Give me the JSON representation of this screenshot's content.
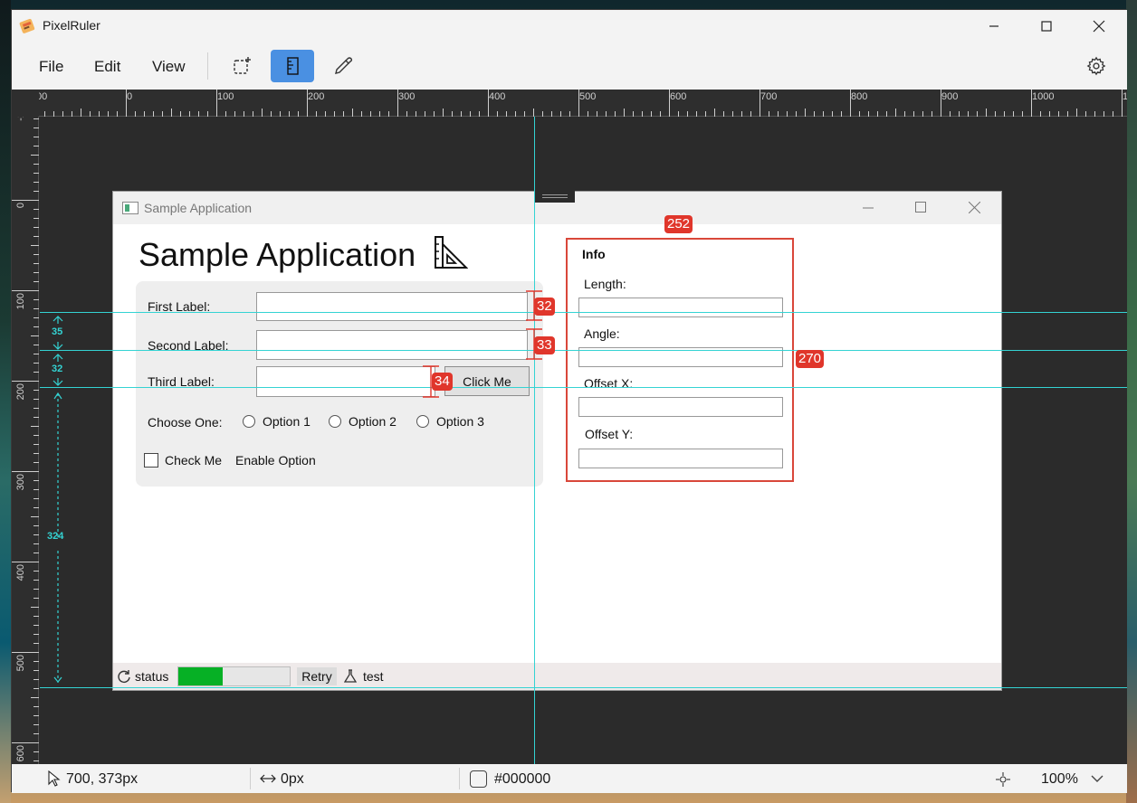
{
  "app": {
    "title": "PixelRuler"
  },
  "menu": {
    "file": "File",
    "edit": "Edit",
    "view": "View"
  },
  "tools": [
    {
      "name": "selection-tool",
      "icon": "dashed-select-icon",
      "active": false
    },
    {
      "name": "ruler-tool",
      "icon": "ruler-icon",
      "active": true
    },
    {
      "name": "color-picker-tool",
      "icon": "eyedropper-icon",
      "active": false
    }
  ],
  "ruler_top": {
    "labels": [
      "00",
      "0",
      "100",
      "200",
      "300",
      "400",
      "500",
      "600",
      "700",
      "800",
      "900",
      "1000",
      "110"
    ]
  },
  "ruler_left": {
    "labels": [
      "-1",
      "0",
      "100",
      "200",
      "300",
      "400",
      "500",
      "600"
    ]
  },
  "sample_app": {
    "title": "Sample Application",
    "heading": "Sample Application",
    "first_label": "First Label:",
    "second_label": "Second Label:",
    "third_label": "Third Label:",
    "click_button": "Click Me",
    "choose_label": "Choose One:",
    "options": [
      "Option 1",
      "Option 2",
      "Option 3"
    ],
    "check_label": "Check Me",
    "enable_label": "Enable Option",
    "info": {
      "title": "Info",
      "length": "Length:",
      "angle": "Angle:",
      "offset_x": "Offset X:",
      "offset_y": "Offset Y:"
    },
    "status": {
      "status_text": "status",
      "progress": 0.4,
      "retry": "Retry",
      "test": "test"
    }
  },
  "measurements": {
    "field1_height": "32",
    "field2_height": "33",
    "field3_height": "34",
    "info_width": "252",
    "info_height": "270",
    "gap_a": "35",
    "gap_b": "32",
    "gap_c": "324"
  },
  "status": {
    "cursor": "700, 373px",
    "distance": "0px",
    "color": "#000000",
    "zoom": "100%"
  },
  "colors": {
    "accent": "#4a90e2",
    "guide": "#34d3d3",
    "measure": "#e0362b",
    "progress_fill": "#06b025"
  }
}
